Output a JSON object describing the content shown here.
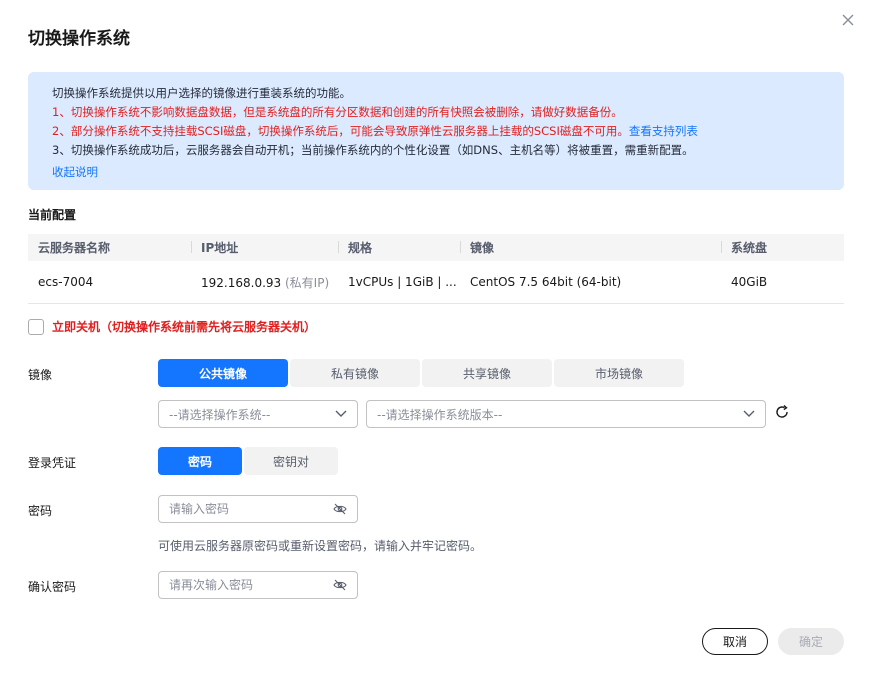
{
  "dialog": {
    "title": "切换操作系统"
  },
  "notice": {
    "intro": "切换操作系统提供以用户选择的镜像进行重装系统的功能。",
    "line1": "1、切换操作系统不影响数据盘数据，但是系统盘的所有分区数据和创建的所有快照会被删除，请做好数据备份。",
    "line2": "2、部分操作系统不支持挂载SCSI磁盘，切换操作系统后，可能会导致原弹性云服务器上挂载的SCSI磁盘不可用。",
    "line2_link": "查看支持列表",
    "line3": "3、切换操作系统成功后，云服务器会自动开机；当前操作系统内的个性化设置（如DNS、主机名等）将被重置，需重新配置。",
    "collapse": "收起说明"
  },
  "current_config": {
    "label": "当前配置",
    "headers": [
      "云服务器名称",
      "IP地址",
      "规格",
      "镜像",
      "系统盘"
    ],
    "row": {
      "name": "ecs-7004",
      "ip": "192.168.0.93",
      "ip_note": "(私有IP)",
      "spec": "1vCPUs | 1GiB | ...",
      "image": "CentOS 7.5 64bit (64-bit)",
      "disk": "40GiB"
    }
  },
  "shutdown": {
    "label": "立即关机（切换操作系统前需先将云服务器关机）",
    "checked": false
  },
  "image": {
    "label": "镜像",
    "tabs": [
      "公共镜像",
      "私有镜像",
      "共享镜像",
      "市场镜像"
    ],
    "active": "公共镜像",
    "os_select": "--请选择操作系统--",
    "version_select": "--请选择操作系统版本--"
  },
  "credential": {
    "label": "登录凭证",
    "tabs": [
      "密码",
      "密钥对"
    ],
    "active": "密码"
  },
  "password": {
    "label": "密码",
    "placeholder": "请输入密码",
    "hint": "可使用云服务器原密码或重新设置密码，请输入并牢记密码。"
  },
  "confirm_password": {
    "label": "确认密码",
    "placeholder": "请再次输入密码"
  },
  "footer": {
    "cancel": "取消",
    "ok": "确定"
  },
  "colors": {
    "primary": "#1476ff",
    "danger": "#e02020",
    "notice_bg": "#dbeafe"
  }
}
